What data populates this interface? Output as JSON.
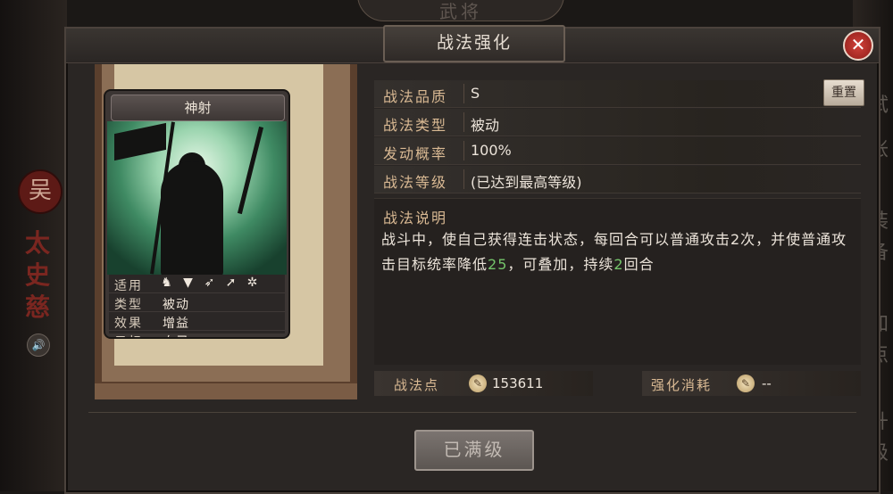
{
  "background": {
    "top_banner": "武将",
    "seal": "吴",
    "general_name": "太史慈",
    "right_chars": [
      "试",
      "帐",
      "装",
      "备",
      "加",
      "点",
      "升",
      "级"
    ]
  },
  "dialog": {
    "title": "战法强化",
    "close_icon": "close-icon"
  },
  "card": {
    "name": "神射",
    "stats": {
      "apply_label": "适用",
      "apply_icons": [
        "cavalry-icon",
        "shield-icon",
        "bow-icon",
        "spear-icon",
        "wheel-icon"
      ],
      "type_label": "类型",
      "type_value": "被动",
      "effect_label": "效果",
      "effect_value": "增益",
      "target_label": "目标",
      "target_value": "自己"
    }
  },
  "info": {
    "quality_label": "战法品质",
    "quality_value": "S",
    "type_label": "战法类型",
    "type_value": "被动",
    "rate_label": "发动概率",
    "rate_value": "100%",
    "level_label": "战法等级",
    "level_value": "(已达到最高等级)",
    "reset_label": "重置"
  },
  "description": {
    "title": "战法说明",
    "text_part1": "战斗中，使自己获得连击状态，每回合可以普通攻击2次，并使普通攻击目标统率降低",
    "highlight1": "25",
    "text_part2": "，可叠加，持续",
    "highlight2": "2",
    "text_part3": "回合"
  },
  "points": {
    "label": "战法点",
    "value": "153611",
    "cost_label": "强化消耗",
    "cost_value": "--"
  },
  "action": {
    "button_label": "已满级"
  }
}
